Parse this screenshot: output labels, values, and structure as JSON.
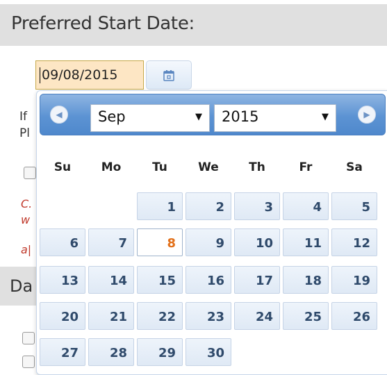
{
  "section": {
    "title": "Preferred Start Date:"
  },
  "date_input": {
    "value": "09/08/2015"
  },
  "background": {
    "para_line1": "If",
    "para_line2": "Pl",
    "red_line1": "C.",
    "red_line2": "w",
    "red_line3": "a|",
    "section2_fragment": "Da"
  },
  "datepicker": {
    "month": "Sep",
    "year": "2015",
    "prev_icon": "chevron-left-icon",
    "next_icon": "chevron-right-icon",
    "weekdays": [
      "Su",
      "Mo",
      "Tu",
      "We",
      "Th",
      "Fr",
      "Sa"
    ],
    "weeks": [
      [
        "",
        "",
        "1",
        "2",
        "3",
        "4",
        "5"
      ],
      [
        "6",
        "7",
        "8",
        "9",
        "10",
        "11",
        "12"
      ],
      [
        "13",
        "14",
        "15",
        "16",
        "17",
        "18",
        "19"
      ],
      [
        "20",
        "21",
        "22",
        "23",
        "24",
        "25",
        "26"
      ],
      [
        "27",
        "28",
        "29",
        "30",
        "",
        "",
        ""
      ]
    ],
    "today": "8"
  },
  "colors": {
    "header_blue": "#5c93d3",
    "input_highlight": "#fde6c4",
    "today_text": "#e2701a",
    "red_text": "#c0392b"
  }
}
